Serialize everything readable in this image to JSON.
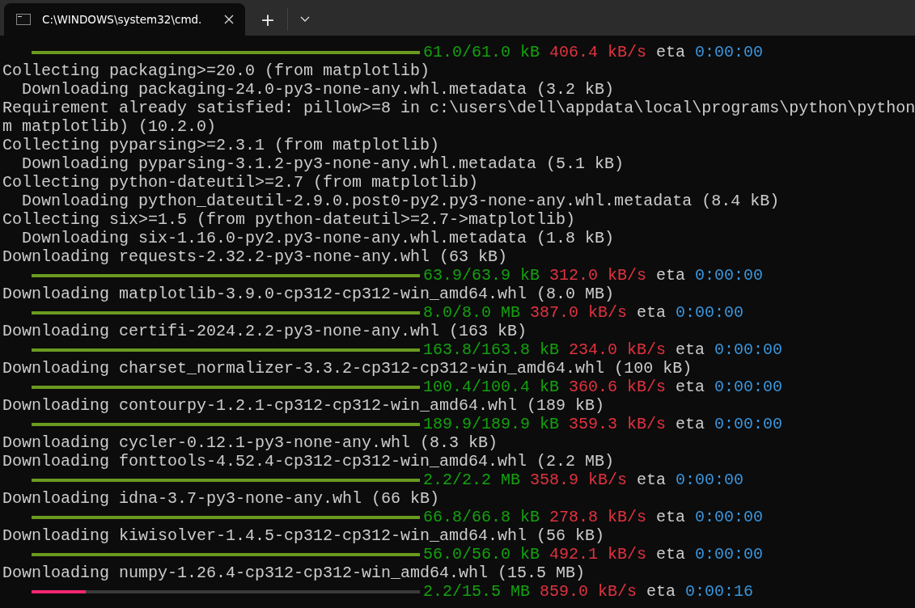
{
  "tabs": [
    {
      "title": "C:\\WINDOWS\\system32\\cmd.",
      "selected": true
    }
  ],
  "new_tab_label": "+",
  "lines": [
    {
      "kind": "progress",
      "level": 1,
      "amount": "61.0/61.0 kB",
      "speed": "406.4 kB/s",
      "eta_label": "eta",
      "eta": "0:00:00"
    },
    {
      "kind": "text",
      "text": "Collecting packaging>=20.0 (from matplotlib)"
    },
    {
      "kind": "text",
      "text": "  Downloading packaging-24.0-py3-none-any.whl.metadata (3.2 kB)"
    },
    {
      "kind": "text",
      "text": "Requirement already satisfied: pillow>=8 in c:\\users\\dell\\appdata\\local\\programs\\python\\python"
    },
    {
      "kind": "text",
      "text": "m matplotlib) (10.2.0)"
    },
    {
      "kind": "text",
      "text": "Collecting pyparsing>=2.3.1 (from matplotlib)"
    },
    {
      "kind": "text",
      "text": "  Downloading pyparsing-3.1.2-py3-none-any.whl.metadata (5.1 kB)"
    },
    {
      "kind": "text",
      "text": "Collecting python-dateutil>=2.7 (from matplotlib)"
    },
    {
      "kind": "text",
      "text": "  Downloading python_dateutil-2.9.0.post0-py2.py3-none-any.whl.metadata (8.4 kB)"
    },
    {
      "kind": "text",
      "text": "Collecting six>=1.5 (from python-dateutil>=2.7->matplotlib)"
    },
    {
      "kind": "text",
      "text": "  Downloading six-1.16.0-py2.py3-none-any.whl.metadata (1.8 kB)"
    },
    {
      "kind": "text",
      "text": "Downloading requests-2.32.2-py3-none-any.whl (63 kB)"
    },
    {
      "kind": "progress",
      "level": 1,
      "amount": "63.9/63.9 kB",
      "speed": "312.0 kB/s",
      "eta_label": "eta",
      "eta": "0:00:00"
    },
    {
      "kind": "text",
      "text": "Downloading matplotlib-3.9.0-cp312-cp312-win_amd64.whl (8.0 MB)"
    },
    {
      "kind": "progress",
      "level": 1,
      "amount": "8.0/8.0 MB",
      "speed": "387.0 kB/s",
      "eta_label": "eta",
      "eta": "0:00:00"
    },
    {
      "kind": "text",
      "text": "Downloading certifi-2024.2.2-py3-none-any.whl (163 kB)"
    },
    {
      "kind": "progress",
      "level": 1,
      "amount": "163.8/163.8 kB",
      "speed": "234.0 kB/s",
      "eta_label": "eta",
      "eta": "0:00:00"
    },
    {
      "kind": "text",
      "text": "Downloading charset_normalizer-3.3.2-cp312-cp312-win_amd64.whl (100 kB)"
    },
    {
      "kind": "progress",
      "level": 1,
      "amount": "100.4/100.4 kB",
      "speed": "360.6 kB/s",
      "eta_label": "eta",
      "eta": "0:00:00"
    },
    {
      "kind": "text",
      "text": "Downloading contourpy-1.2.1-cp312-cp312-win_amd64.whl (189 kB)"
    },
    {
      "kind": "progress",
      "level": 1,
      "amount": "189.9/189.9 kB",
      "speed": "359.3 kB/s",
      "eta_label": "eta",
      "eta": "0:00:00"
    },
    {
      "kind": "text",
      "text": "Downloading cycler-0.12.1-py3-none-any.whl (8.3 kB)"
    },
    {
      "kind": "text",
      "text": "Downloading fonttools-4.52.4-cp312-cp312-win_amd64.whl (2.2 MB)"
    },
    {
      "kind": "progress",
      "level": 1,
      "amount": "2.2/2.2 MB",
      "speed": "358.9 kB/s",
      "eta_label": "eta",
      "eta": "0:00:00"
    },
    {
      "kind": "text",
      "text": "Downloading idna-3.7-py3-none-any.whl (66 kB)"
    },
    {
      "kind": "progress",
      "level": 1,
      "amount": "66.8/66.8 kB",
      "speed": "278.8 kB/s",
      "eta_label": "eta",
      "eta": "0:00:00"
    },
    {
      "kind": "text",
      "text": "Downloading kiwisolver-1.4.5-cp312-cp312-win_amd64.whl (56 kB)"
    },
    {
      "kind": "progress",
      "level": 1,
      "amount": "56.0/56.0 kB",
      "speed": "492.1 kB/s",
      "eta_label": "eta",
      "eta": "0:00:00"
    },
    {
      "kind": "text",
      "text": "Downloading numpy-1.26.4-cp312-cp312-win_amd64.whl (15.5 MB)"
    },
    {
      "kind": "progress",
      "level": 0.14,
      "amount": "2.2/15.5 MB",
      "speed": "859.0 kB/s",
      "eta_label": "eta",
      "eta": "0:00:16"
    }
  ]
}
